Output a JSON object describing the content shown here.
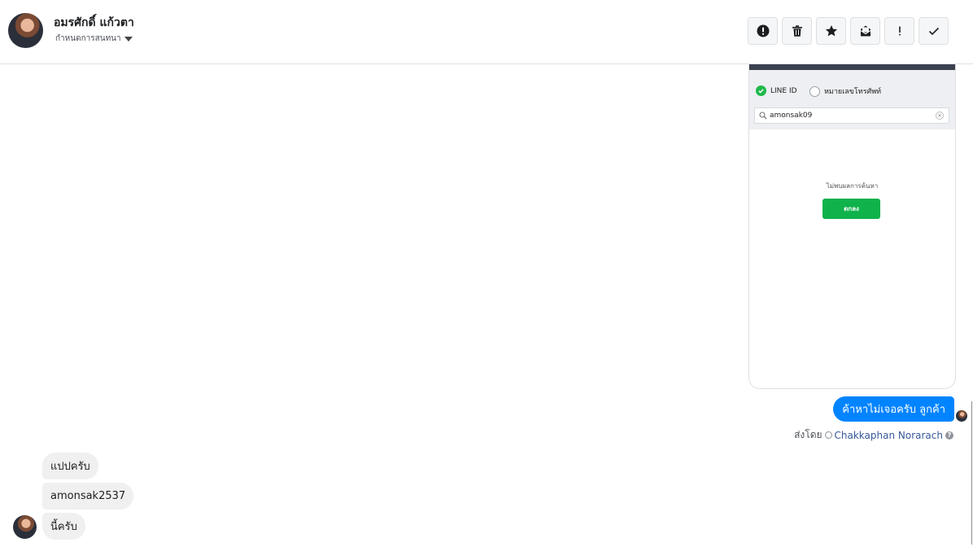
{
  "header": {
    "contact_name": "อมรศักดิ์ แก้วตา",
    "conversation_label": "กำหนดการสนทนา",
    "actions": [
      {
        "name": "report-spam",
        "icon": "alert-circle-icon"
      },
      {
        "name": "delete",
        "icon": "trash-icon"
      },
      {
        "name": "star",
        "icon": "star-icon"
      },
      {
        "name": "mark-unread",
        "icon": "envelope-icon"
      },
      {
        "name": "mark-important",
        "icon": "exclamation-icon"
      },
      {
        "name": "mark-done",
        "icon": "checkmark-icon"
      }
    ]
  },
  "attachment": {
    "option_line_id": "LINE ID",
    "option_phone": "หมายเลขโทรศัพท์",
    "search_value": "amonsak09",
    "no_result_text": "ไม่พบผลการค้นหา",
    "ok_button": "ตกลง"
  },
  "outgoing": {
    "message": "ค้าหาไม่เจอครับ ลูกค้า",
    "sent_by_prefix": "ส่งโดย",
    "agent_name": "Chakkaphan Norarach",
    "help_glyph": "?"
  },
  "incoming": {
    "messages": [
      "แปปครับ",
      "amonsak2537",
      "นี้ครับ"
    ]
  },
  "colors": {
    "brand_blue": "#0084ff",
    "line_green": "#0fb24b",
    "incoming_bubble": "#f1f0f0"
  }
}
